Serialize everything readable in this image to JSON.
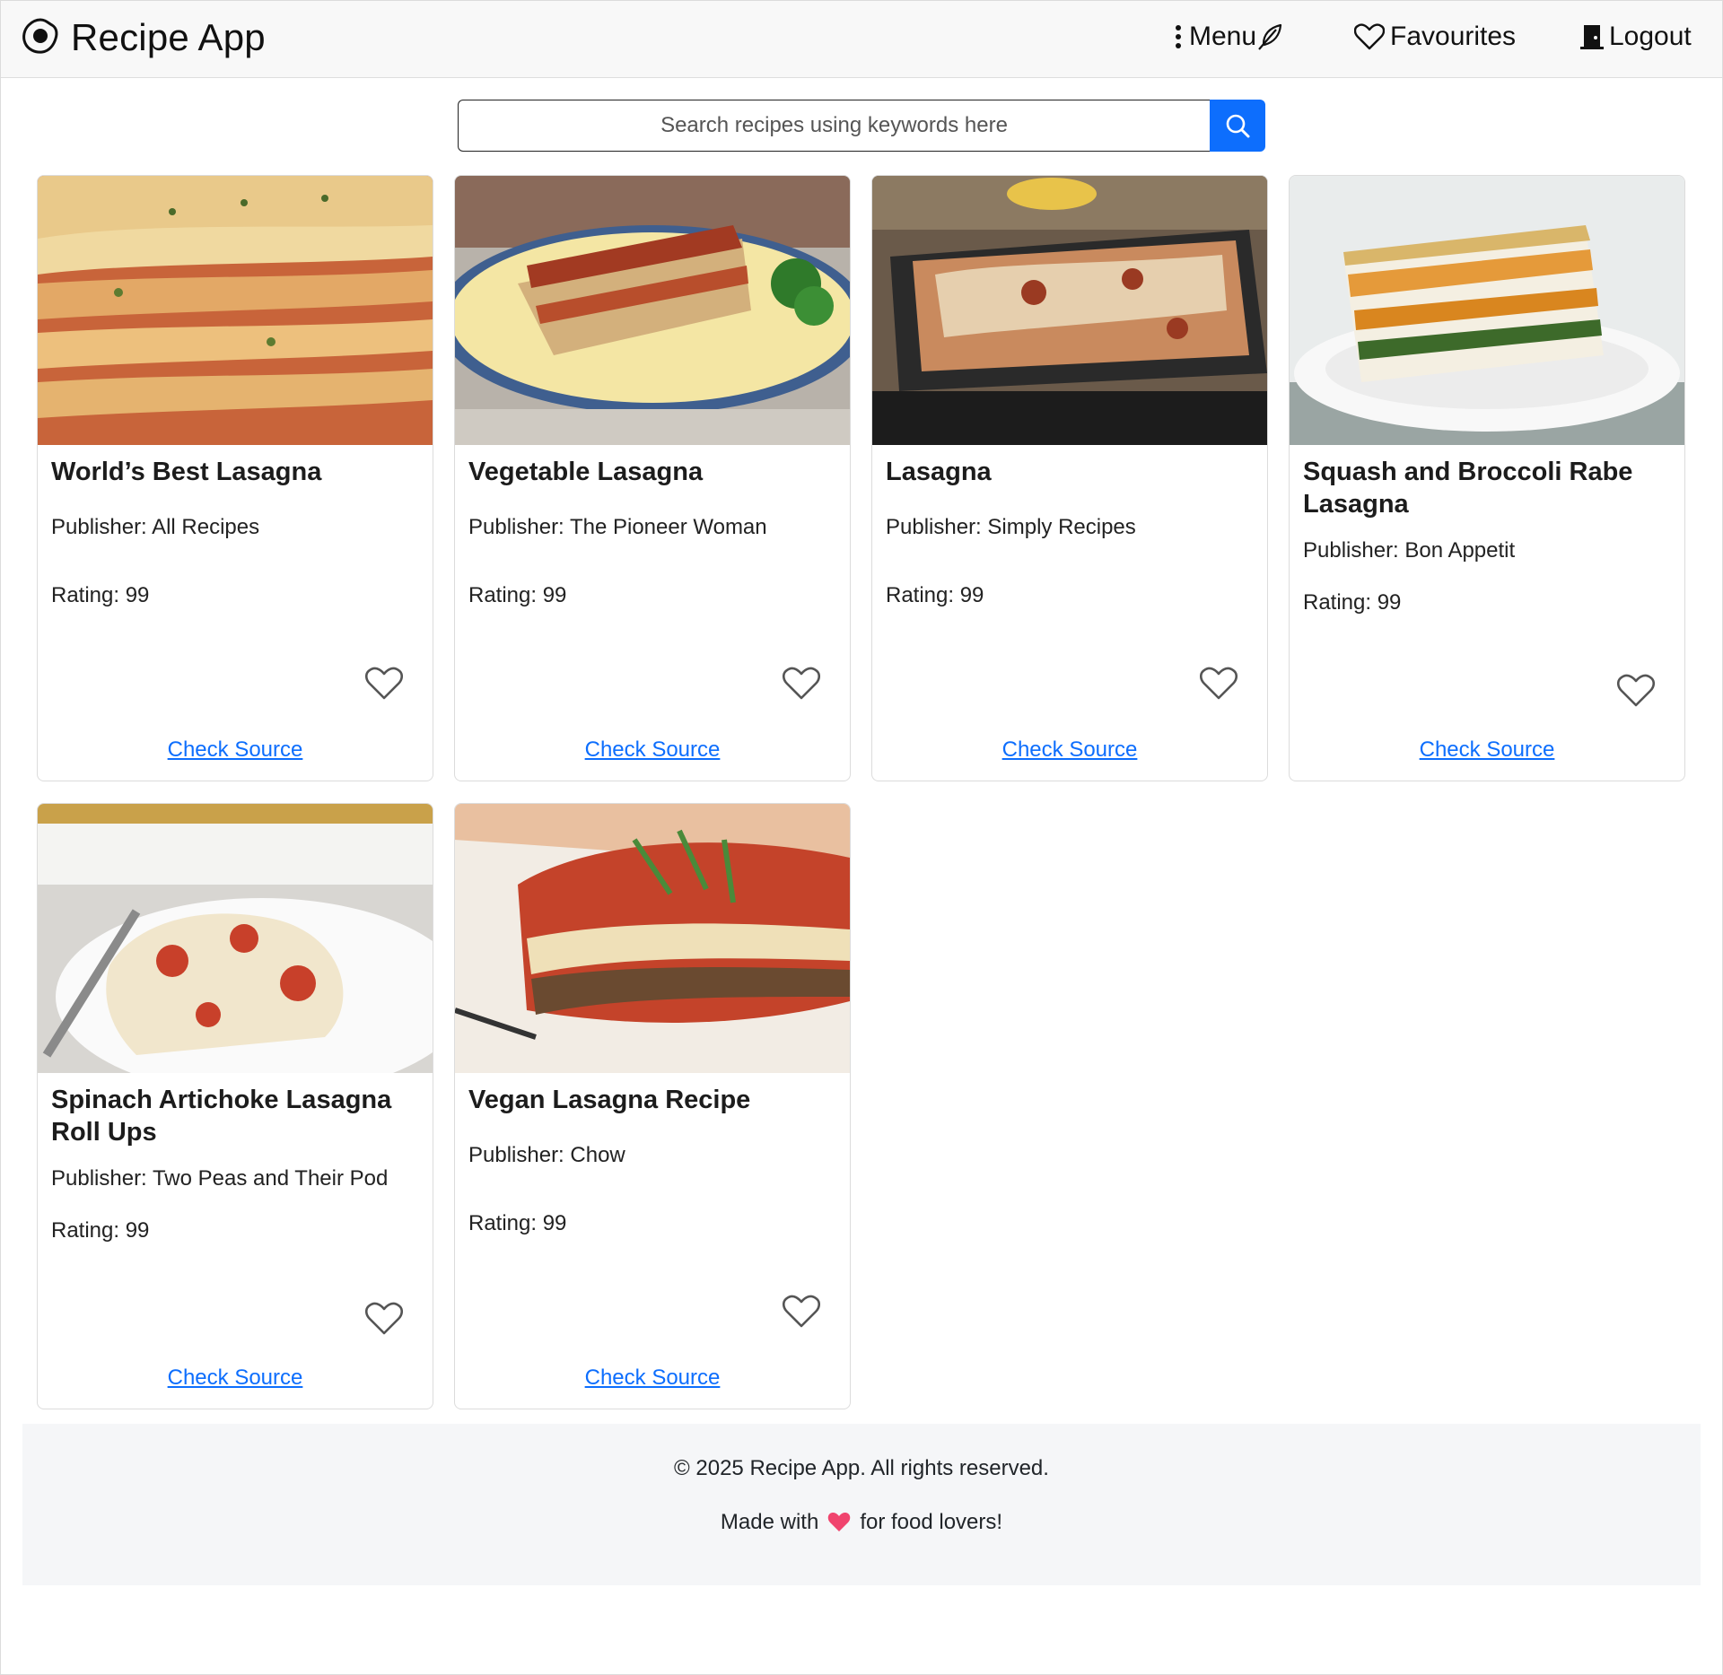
{
  "app": {
    "title": "Recipe App",
    "logo_icon": "egg-logo-icon"
  },
  "nav": {
    "menu_label": "Menu",
    "favourites_label": "Favourites",
    "logout_label": "Logout"
  },
  "search": {
    "placeholder": "Search recipes using keywords here",
    "value": ""
  },
  "accent_color": "#0d6efd",
  "recipes": [
    {
      "title": "World’s Best Lasagna",
      "publisher": "Publisher: All Recipes",
      "rating": "Rating: 99",
      "link": "Check Source"
    },
    {
      "title": "Vegetable Lasagna",
      "publisher": "Publisher: The Pioneer Woman",
      "rating": "Rating: 99",
      "link": "Check Source"
    },
    {
      "title": "Lasagna",
      "publisher": "Publisher: Simply Recipes",
      "rating": "Rating: 99",
      "link": "Check Source"
    },
    {
      "title": "Squash and Broccoli Rabe Lasagna",
      "publisher": "Publisher: Bon Appetit",
      "rating": "Rating: 99",
      "link": "Check Source"
    },
    {
      "title": "Spinach Artichoke Lasagna Roll Ups",
      "publisher": "Publisher: Two Peas and Their Pod",
      "rating": "Rating: 99",
      "link": "Check Source"
    },
    {
      "title": "Vegan Lasagna Recipe",
      "publisher": "Publisher: Chow",
      "rating": "Rating: 99",
      "link": "Check Source"
    }
  ],
  "footer": {
    "copyright": "© 2025 Recipe App. All rights reserved.",
    "made_with_prefix": "Made with",
    "made_with_suffix": "for food lovers!"
  }
}
